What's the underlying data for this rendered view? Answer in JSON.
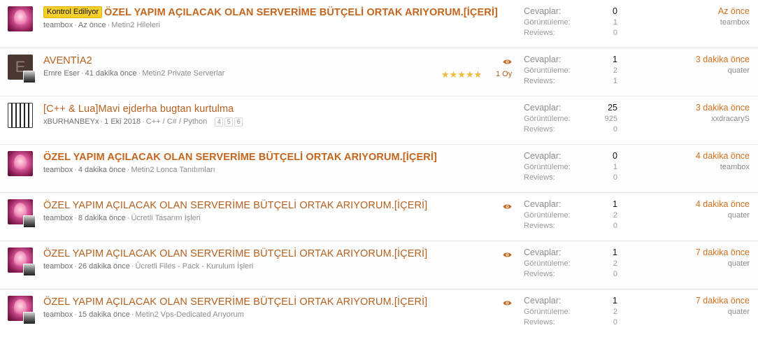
{
  "threads": [
    {
      "badge": "Kontrol Ediliyor",
      "title": "ÖZEL YAPIM AÇILACAK OLAN SERVERİME BÜTÇELİ ORTAK ARIYORUM.[İÇERİ]",
      "author": "teambox",
      "time": "Az önce",
      "forum": "Metin2 Hileleri",
      "replies_label": "Cevaplar:",
      "replies": "0",
      "views_label": "Görüntüleme:",
      "views": "1",
      "reviews_label": "Reviews:",
      "reviews": "0",
      "last_time": "Az önce",
      "last_user": "teambox"
    },
    {
      "title": "AVENTİA2",
      "avatar_letter": "E",
      "author": "Emre Eser",
      "time": "41 dakika önce",
      "forum": "Metin2 Private Serverlar",
      "rating_stars": 5,
      "votes": "1 Oy",
      "replies_label": "Cevaplar:",
      "replies": "1",
      "views_label": "Görüntüleme:",
      "views": "2",
      "reviews_label": "Reviews:",
      "reviews": "1",
      "last_time": "3 dakika önce",
      "last_user": "quater"
    },
    {
      "title": "[C++ & Lua]Mavi ejderha bugtan kurtulma",
      "author": "xBURHANBEYx",
      "time": "1 Eki 2018",
      "forum": "C++ / C# / Python",
      "pages": [
        "4",
        "5",
        "6"
      ],
      "replies_label": "Cevaplar:",
      "replies": "25",
      "views_label": "Görüntüleme:",
      "views": "925",
      "reviews_label": "Reviews:",
      "reviews": "0",
      "last_time": "3 dakika önce",
      "last_user": "xxdracaryS"
    },
    {
      "title": "ÖZEL YAPIM AÇILACAK OLAN SERVERİME BÜTÇELİ ORTAK ARIYORUM.[İÇERİ]",
      "author": "teambox",
      "time": "4 dakika önce",
      "forum": "Metin2 Lonca Tanıtımları",
      "replies_label": "Cevaplar:",
      "replies": "0",
      "views_label": "Görüntüleme:",
      "views": "1",
      "reviews_label": "Reviews:",
      "reviews": "0",
      "last_time": "4 dakika önce",
      "last_user": "teambox"
    },
    {
      "title": "ÖZEL YAPIM AÇILACAK OLAN SERVERİME BÜTÇELİ ORTAK ARIYORUM.[İÇERİ]",
      "author": "teambox",
      "time": "8 dakika önce",
      "forum": "Ücretli Tasarım İşleri",
      "replies_label": "Cevaplar:",
      "replies": "1",
      "views_label": "Görüntüleme:",
      "views": "2",
      "reviews_label": "Reviews:",
      "reviews": "0",
      "last_time": "4 dakika önce",
      "last_user": "quater"
    },
    {
      "title": "ÖZEL YAPIM AÇILACAK OLAN SERVERİME BÜTÇELİ ORTAK ARIYORUM.[İÇERİ]",
      "author": "teambox",
      "time": "26 dakika önce",
      "forum": "Ücretli Files - Pack - Kurulum İşleri",
      "replies_label": "Cevaplar:",
      "replies": "1",
      "views_label": "Görüntüleme:",
      "views": "2",
      "reviews_label": "Reviews:",
      "reviews": "0",
      "last_time": "7 dakika önce",
      "last_user": "quater"
    },
    {
      "title": "ÖZEL YAPIM AÇILACAK OLAN SERVERİME BÜTÇELİ ORTAK ARIYORUM.[İÇERİ]",
      "author": "teambox",
      "time": "15 dakika önce",
      "forum": "Metin2 Vps-Dedicated Arıyorum",
      "replies_label": "Cevaplar:",
      "replies": "1",
      "views_label": "Görüntüleme:",
      "views": "2",
      "reviews_label": "Reviews:",
      "reviews": "0",
      "last_time": "7 dakika önce",
      "last_user": "quater"
    }
  ],
  "colors": {
    "title": "#b5601f",
    "last_time": "#d2701e",
    "badge": "#f5d02a",
    "star": "#f5b840",
    "muted": "#8c8c8c"
  }
}
